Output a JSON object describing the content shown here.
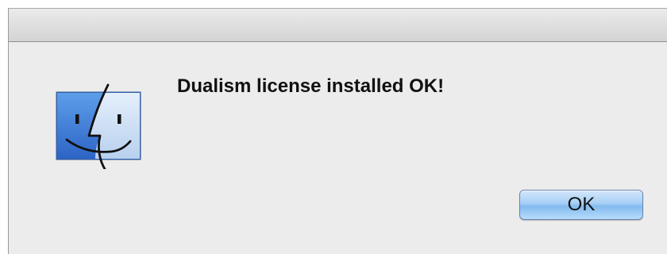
{
  "dialog": {
    "icon": "finder-icon",
    "message": "Dualism license installed OK!",
    "ok_label": "OK",
    "accent_color": "#8cc0f0",
    "background_color": "#ececec"
  }
}
